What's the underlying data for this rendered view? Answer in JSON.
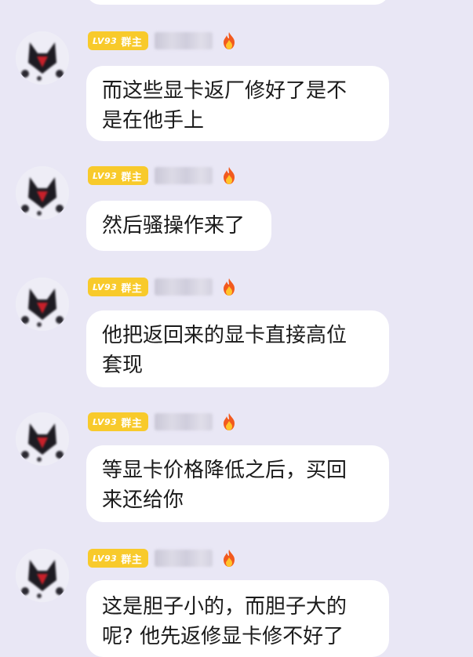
{
  "messages": [
    {
      "badge_level": "LV93",
      "badge_role": "群主",
      "lines": [
        "而这些显卡返厂修好了是不",
        "是在他手上"
      ]
    },
    {
      "badge_level": "LV93",
      "badge_role": "群主",
      "lines": [
        "然后骚操作来了"
      ]
    },
    {
      "badge_level": "LV93",
      "badge_role": "群主",
      "lines": [
        "他把返回来的显卡直接高位",
        "套现"
      ]
    },
    {
      "badge_level": "LV93",
      "badge_role": "群主",
      "lines": [
        "等显卡价格降低之后，买回",
        "来还给你"
      ]
    },
    {
      "badge_level": "LV93",
      "badge_role": "群主",
      "lines": [
        "这是胆子小的，而胆子大的",
        "呢?  他先返修显卡修不好了"
      ]
    }
  ],
  "colors": {
    "background": "#e9e7f5",
    "bubble": "#ffffff",
    "badge": "#f8ca2b",
    "text": "#1a1a1a"
  },
  "icons": {
    "fire": "fire-icon",
    "avatar": "avatar"
  }
}
